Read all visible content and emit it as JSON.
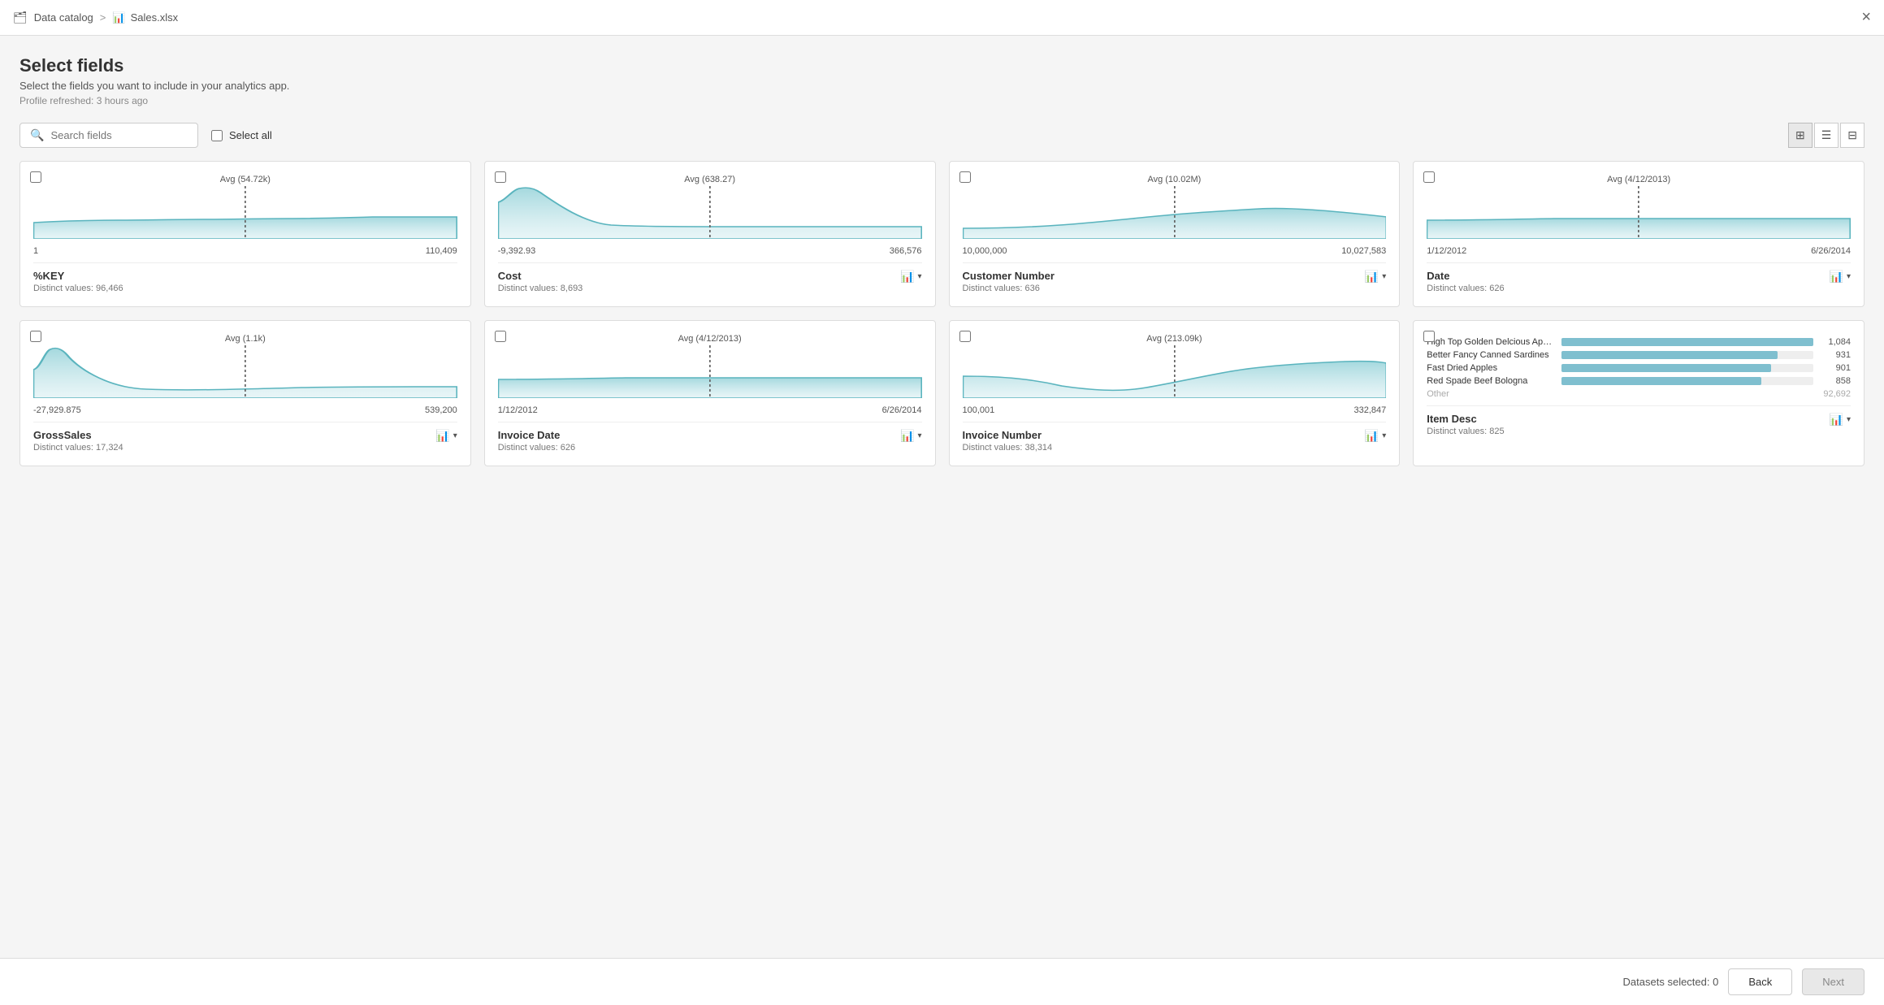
{
  "topbar": {
    "data_catalog_label": "Data catalog",
    "separator": ">",
    "file_icon": "📄",
    "file_name": "Sales.xlsx",
    "close_label": "×"
  },
  "header": {
    "title": "Select fields",
    "subtitle": "Select the fields you want to include in your analytics app.",
    "refresh": "Profile refreshed: 3 hours ago"
  },
  "toolbar": {
    "search_placeholder": "Search fields",
    "select_all_label": "Select all",
    "view_grid_label": "⊞",
    "view_list_label": "☰",
    "view_table_label": "⊟"
  },
  "cards": [
    {
      "id": "key",
      "name": "%KEY",
      "distinct_label": "Distinct values:",
      "distinct_value": "96,466",
      "avg_label": "Avg (54.72k)",
      "range_min": "1",
      "range_max": "110,409",
      "has_chart_icon": false,
      "chart_type": "area"
    },
    {
      "id": "cost",
      "name": "Cost",
      "distinct_label": "Distinct values:",
      "distinct_value": "8,693",
      "avg_label": "Avg (638.27)",
      "range_min": "-9,392.93",
      "range_max": "366,576",
      "has_chart_icon": true,
      "chart_type": "area_spike"
    },
    {
      "id": "customer_number",
      "name": "Customer Number",
      "distinct_label": "Distinct values:",
      "distinct_value": "636",
      "avg_label": "Avg (10.02M)",
      "range_min": "10,000,000",
      "range_max": "10,027,583",
      "has_chart_icon": true,
      "chart_type": "area_hill"
    },
    {
      "id": "date",
      "name": "Date",
      "distinct_label": "Distinct values:",
      "distinct_value": "626",
      "avg_label": "Avg (4/12/2013)",
      "range_min": "1/12/2012",
      "range_max": "6/26/2014",
      "has_chart_icon": true,
      "chart_type": "area_flat"
    },
    {
      "id": "gross_sales",
      "name": "GrossSales",
      "distinct_label": "Distinct values:",
      "distinct_value": "17,324",
      "avg_label": "Avg (1.1k)",
      "range_min": "-27,929.875",
      "range_max": "539,200",
      "has_chart_icon": true,
      "chart_type": "area_spike2"
    },
    {
      "id": "invoice_date",
      "name": "Invoice Date",
      "distinct_label": "Distinct values:",
      "distinct_value": "626",
      "avg_label": "Avg (4/12/2013)",
      "range_min": "1/12/2012",
      "range_max": "6/26/2014",
      "has_chart_icon": true,
      "chart_type": "area_flat2"
    },
    {
      "id": "invoice_number",
      "name": "Invoice Number",
      "distinct_label": "Distinct values:",
      "distinct_value": "38,314",
      "avg_label": "Avg (213.09k)",
      "range_min": "100,001",
      "range_max": "332,847",
      "has_chart_icon": true,
      "chart_type": "area_dip"
    },
    {
      "id": "item_desc",
      "name": "Item Desc",
      "distinct_label": "Distinct values:",
      "distinct_value": "825",
      "has_chart_icon": true,
      "chart_type": "bar",
      "bar_items": [
        {
          "label": "High Top Golden Delcious Apples",
          "value": 1084,
          "max": 1084
        },
        {
          "label": "Better Fancy Canned Sardines",
          "value": 931,
          "max": 1084
        },
        {
          "label": "Fast Dried Apples",
          "value": 901,
          "max": 1084
        },
        {
          "label": "Red Spade Beef Bologna",
          "value": 858,
          "max": 1084
        },
        {
          "label": "Other",
          "value": 92692,
          "max": 1084,
          "is_other": true
        }
      ]
    }
  ],
  "footer": {
    "datasets_selected_label": "Datasets selected:",
    "datasets_selected_count": "0",
    "back_label": "Back",
    "next_label": "Next"
  }
}
